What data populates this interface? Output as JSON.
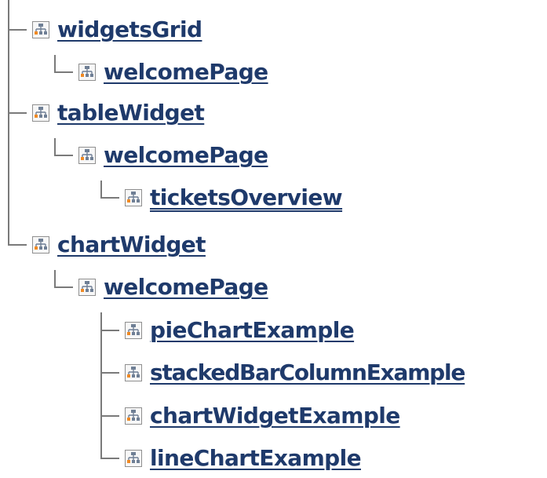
{
  "tree": {
    "icon": "hierarchy-icon",
    "nodes": [
      {
        "label": "widgetsGrid"
      },
      {
        "label": "welcomePage"
      },
      {
        "label": "tableWidget"
      },
      {
        "label": "welcomePage"
      },
      {
        "label": "ticketsOverview"
      },
      {
        "label": "chartWidget"
      },
      {
        "label": "welcomePage"
      },
      {
        "label": "pieChartExample"
      },
      {
        "label": "stackedBarColumnExample"
      },
      {
        "label": "chartWidgetExample"
      },
      {
        "label": "lineChartExample"
      }
    ]
  },
  "colors": {
    "link_text": "#1f3a6b",
    "connector": "#7a7a7a",
    "icon_border": "#8f8f8f",
    "icon_hierarchy": "#6f7f95",
    "icon_accent": "#f08a24"
  }
}
